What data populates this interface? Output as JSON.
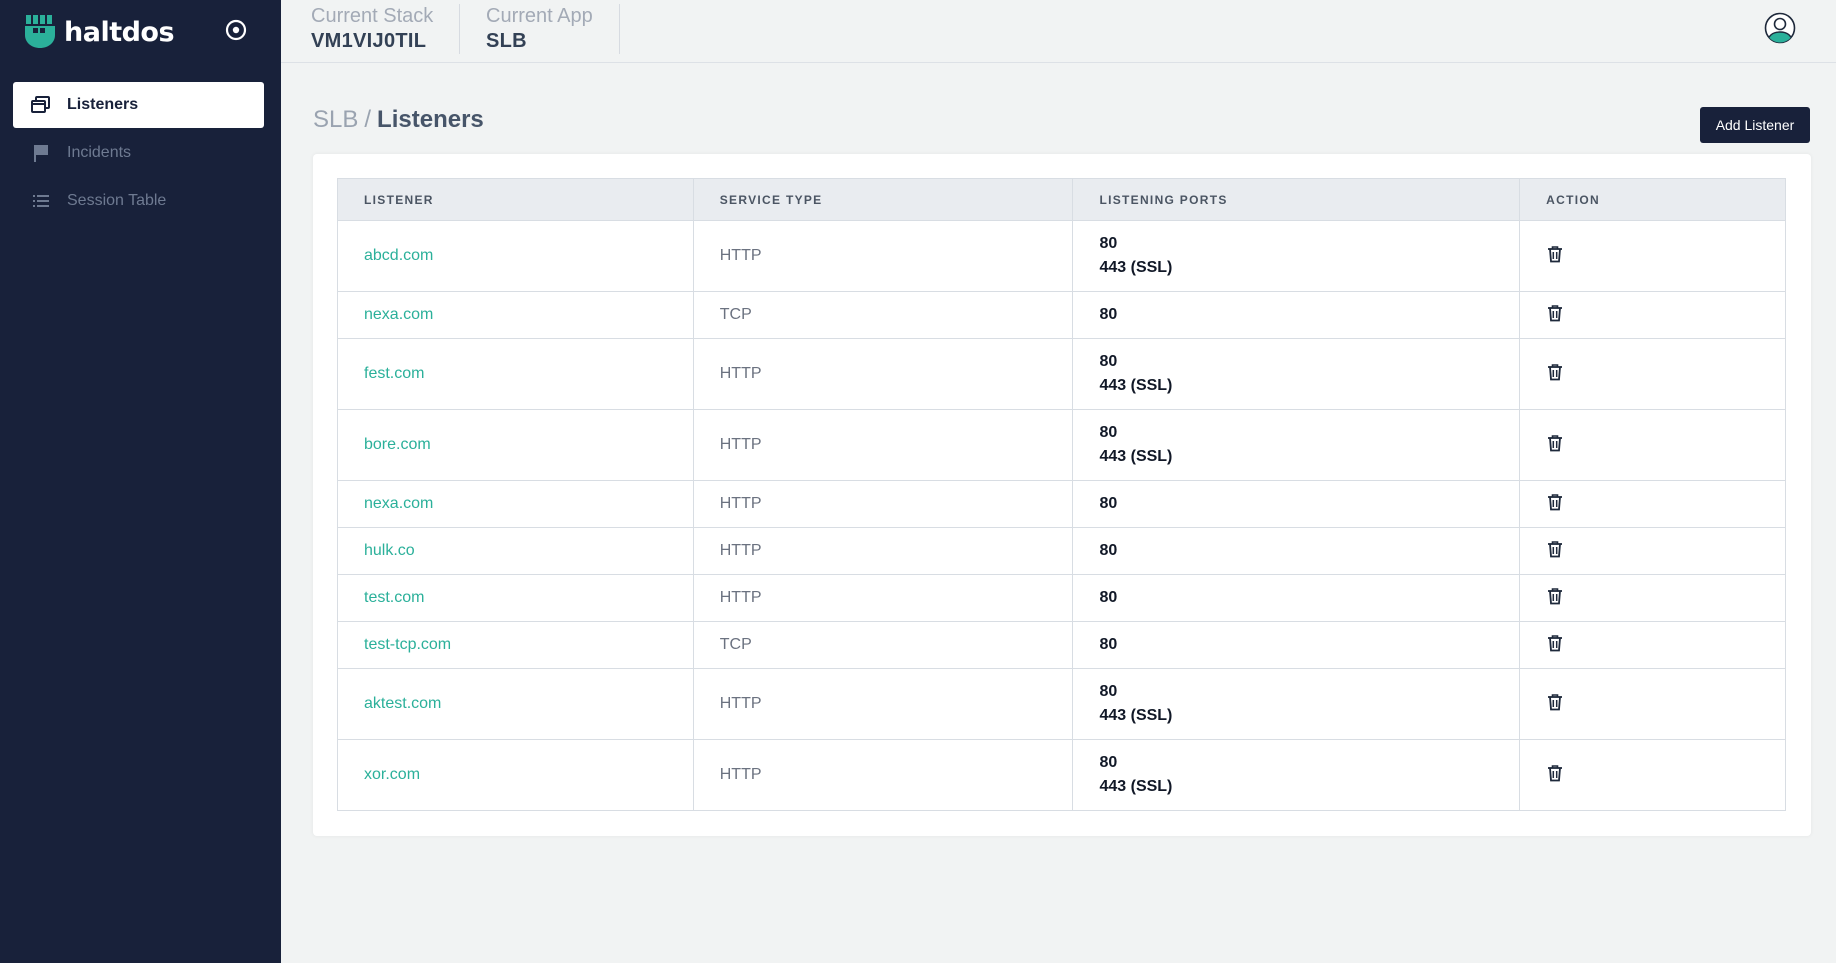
{
  "brand": {
    "name": "haltdos"
  },
  "sidebar": {
    "items": [
      {
        "label": "Listeners",
        "icon": "window-icon",
        "active": true
      },
      {
        "label": "Incidents",
        "icon": "flag-icon",
        "active": false
      },
      {
        "label": "Session Table",
        "icon": "list-icon",
        "active": false
      }
    ]
  },
  "topbar": {
    "stack_label": "Current Stack",
    "stack_value": "VM1VIJ0TIL",
    "app_label": "Current App",
    "app_value": "SLB",
    "avatar_icon": "user-avatar-icon"
  },
  "page": {
    "breadcrumb_parent": "SLB",
    "breadcrumb_sep": "/",
    "breadcrumb_current": "Listeners",
    "add_button_label": "Add Listener"
  },
  "table": {
    "columns": [
      "LISTENER",
      "SERVICE TYPE",
      "LISTENING PORTS",
      "ACTION"
    ],
    "rows": [
      {
        "listener": "abcd.com",
        "service_type": "HTTP",
        "ports": [
          "80",
          "443 (SSL)"
        ]
      },
      {
        "listener": "nexa.com",
        "service_type": "TCP",
        "ports": [
          "80"
        ]
      },
      {
        "listener": "fest.com",
        "service_type": "HTTP",
        "ports": [
          "80",
          "443 (SSL)"
        ]
      },
      {
        "listener": "bore.com",
        "service_type": "HTTP",
        "ports": [
          "80",
          "443 (SSL)"
        ]
      },
      {
        "listener": "nexa.com",
        "service_type": "HTTP",
        "ports": [
          "80"
        ]
      },
      {
        "listener": "hulk.co",
        "service_type": "HTTP",
        "ports": [
          "80"
        ]
      },
      {
        "listener": "test.com",
        "service_type": "HTTP",
        "ports": [
          "80"
        ]
      },
      {
        "listener": "test-tcp.com",
        "service_type": "TCP",
        "ports": [
          "80"
        ]
      },
      {
        "listener": "aktest.com",
        "service_type": "HTTP",
        "ports": [
          "80",
          "443 (SSL)"
        ]
      },
      {
        "listener": "xor.com",
        "service_type": "HTTP",
        "ports": [
          "80",
          "443 (SSL)"
        ]
      }
    ],
    "action_icon": "trash-icon"
  },
  "colors": {
    "sidebar_bg": "#18213a",
    "accent": "#2bb09a",
    "button_bg": "#18213a",
    "page_bg": "#f1f3f3"
  }
}
